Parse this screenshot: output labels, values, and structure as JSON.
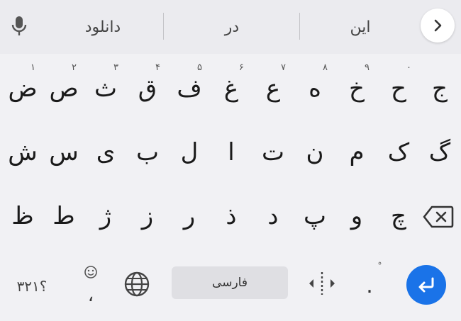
{
  "suggestion_bar": {
    "suggestions": [
      "دانلود",
      "در",
      "این"
    ],
    "mic_icon": "microphone-icon",
    "collapse_icon": "chevron-right-icon"
  },
  "rows": [
    [
      {
        "char": "ض",
        "hint": "۱"
      },
      {
        "char": "ص",
        "hint": "۲"
      },
      {
        "char": "ث",
        "hint": "۳"
      },
      {
        "char": "ق",
        "hint": "۴"
      },
      {
        "char": "ف",
        "hint": "۵"
      },
      {
        "char": "غ",
        "hint": "۶"
      },
      {
        "char": "ع",
        "hint": "۷"
      },
      {
        "char": "ه",
        "hint": "۸"
      },
      {
        "char": "خ",
        "hint": "۹"
      },
      {
        "char": "ح",
        "hint": "۰"
      },
      {
        "char": "ج",
        "hint": ""
      }
    ],
    [
      {
        "char": "ش"
      },
      {
        "char": "س"
      },
      {
        "char": "ی"
      },
      {
        "char": "ب"
      },
      {
        "char": "ل"
      },
      {
        "char": "ا"
      },
      {
        "char": "ت"
      },
      {
        "char": "ن"
      },
      {
        "char": "م"
      },
      {
        "char": "ک"
      },
      {
        "char": "گ"
      }
    ],
    [
      {
        "char": "ظ"
      },
      {
        "char": "ط"
      },
      {
        "char": "ژ"
      },
      {
        "char": "ز"
      },
      {
        "char": "ر"
      },
      {
        "char": "ذ"
      },
      {
        "char": "د"
      },
      {
        "char": "پ"
      },
      {
        "char": "و"
      },
      {
        "char": "چ"
      }
    ]
  ],
  "bottom_row": {
    "symbols_label": "؟۳۲۱",
    "comma_char": "،",
    "space_label": "فارسی",
    "period_char": ".",
    "period_hint": "ْ"
  },
  "colors": {
    "enter_key": "#1a73e8",
    "background": "#f1f1f4"
  }
}
